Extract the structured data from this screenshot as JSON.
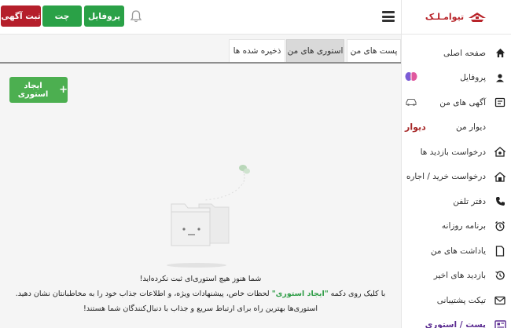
{
  "brand": {
    "logo_text": "تیوامـلـک",
    "accent": "#b8242a"
  },
  "header": {
    "post_ad_label": "ثبت آگهی",
    "chat_label": "چت",
    "profile_label": "پروفایل"
  },
  "sidebar": {
    "items": [
      {
        "label": "صفحه اصلی",
        "icon": "home-icon"
      },
      {
        "label": "پروفایل",
        "icon": "user-icon"
      },
      {
        "label": "آگهی های من",
        "icon": "ads-icon"
      },
      {
        "label": "دیوار من",
        "icon": "wall-icon",
        "badge": "دیوار"
      },
      {
        "label": "درخواست بازدید ها",
        "icon": "visit-request-icon"
      },
      {
        "label": "درخواست خرید / اجاره",
        "icon": "buy-request-icon"
      },
      {
        "label": "دفتر تلفن",
        "icon": "phone-icon"
      },
      {
        "label": "برنامه روزانه",
        "icon": "alarm-icon"
      },
      {
        "label": "یاداشت های من",
        "icon": "note-icon"
      },
      {
        "label": "بازدید های اخیر",
        "icon": "history-icon"
      },
      {
        "label": "تیکت پشتیبانی",
        "icon": "mail-icon"
      },
      {
        "label": "پست / استوری",
        "icon": "story-icon",
        "active": true
      }
    ]
  },
  "tabs": {
    "posts": "پست های من",
    "stories": "استوری های من",
    "saved": "ذخیره شده ها"
  },
  "create_story": {
    "label": "ایجاد استوری",
    "plus": "+"
  },
  "empty_state": {
    "line1": "شما هنوز هیچ استوری‌ای ثبت نکرده‌اید!",
    "line2_before": "با کلیک روی دکمه ",
    "line2_highlight": "\"ایجاد استوری\"",
    "line2_after": " لحظات خاص، پیشنهادات ویژه، و اطلاعات جذاب خود را به مخاطبانتان نشان دهید.",
    "line3": "استوری‌ها بهترین راه برای ارتباط سریع و جذاب با دنبال‌کنندگان شما هستند!"
  }
}
